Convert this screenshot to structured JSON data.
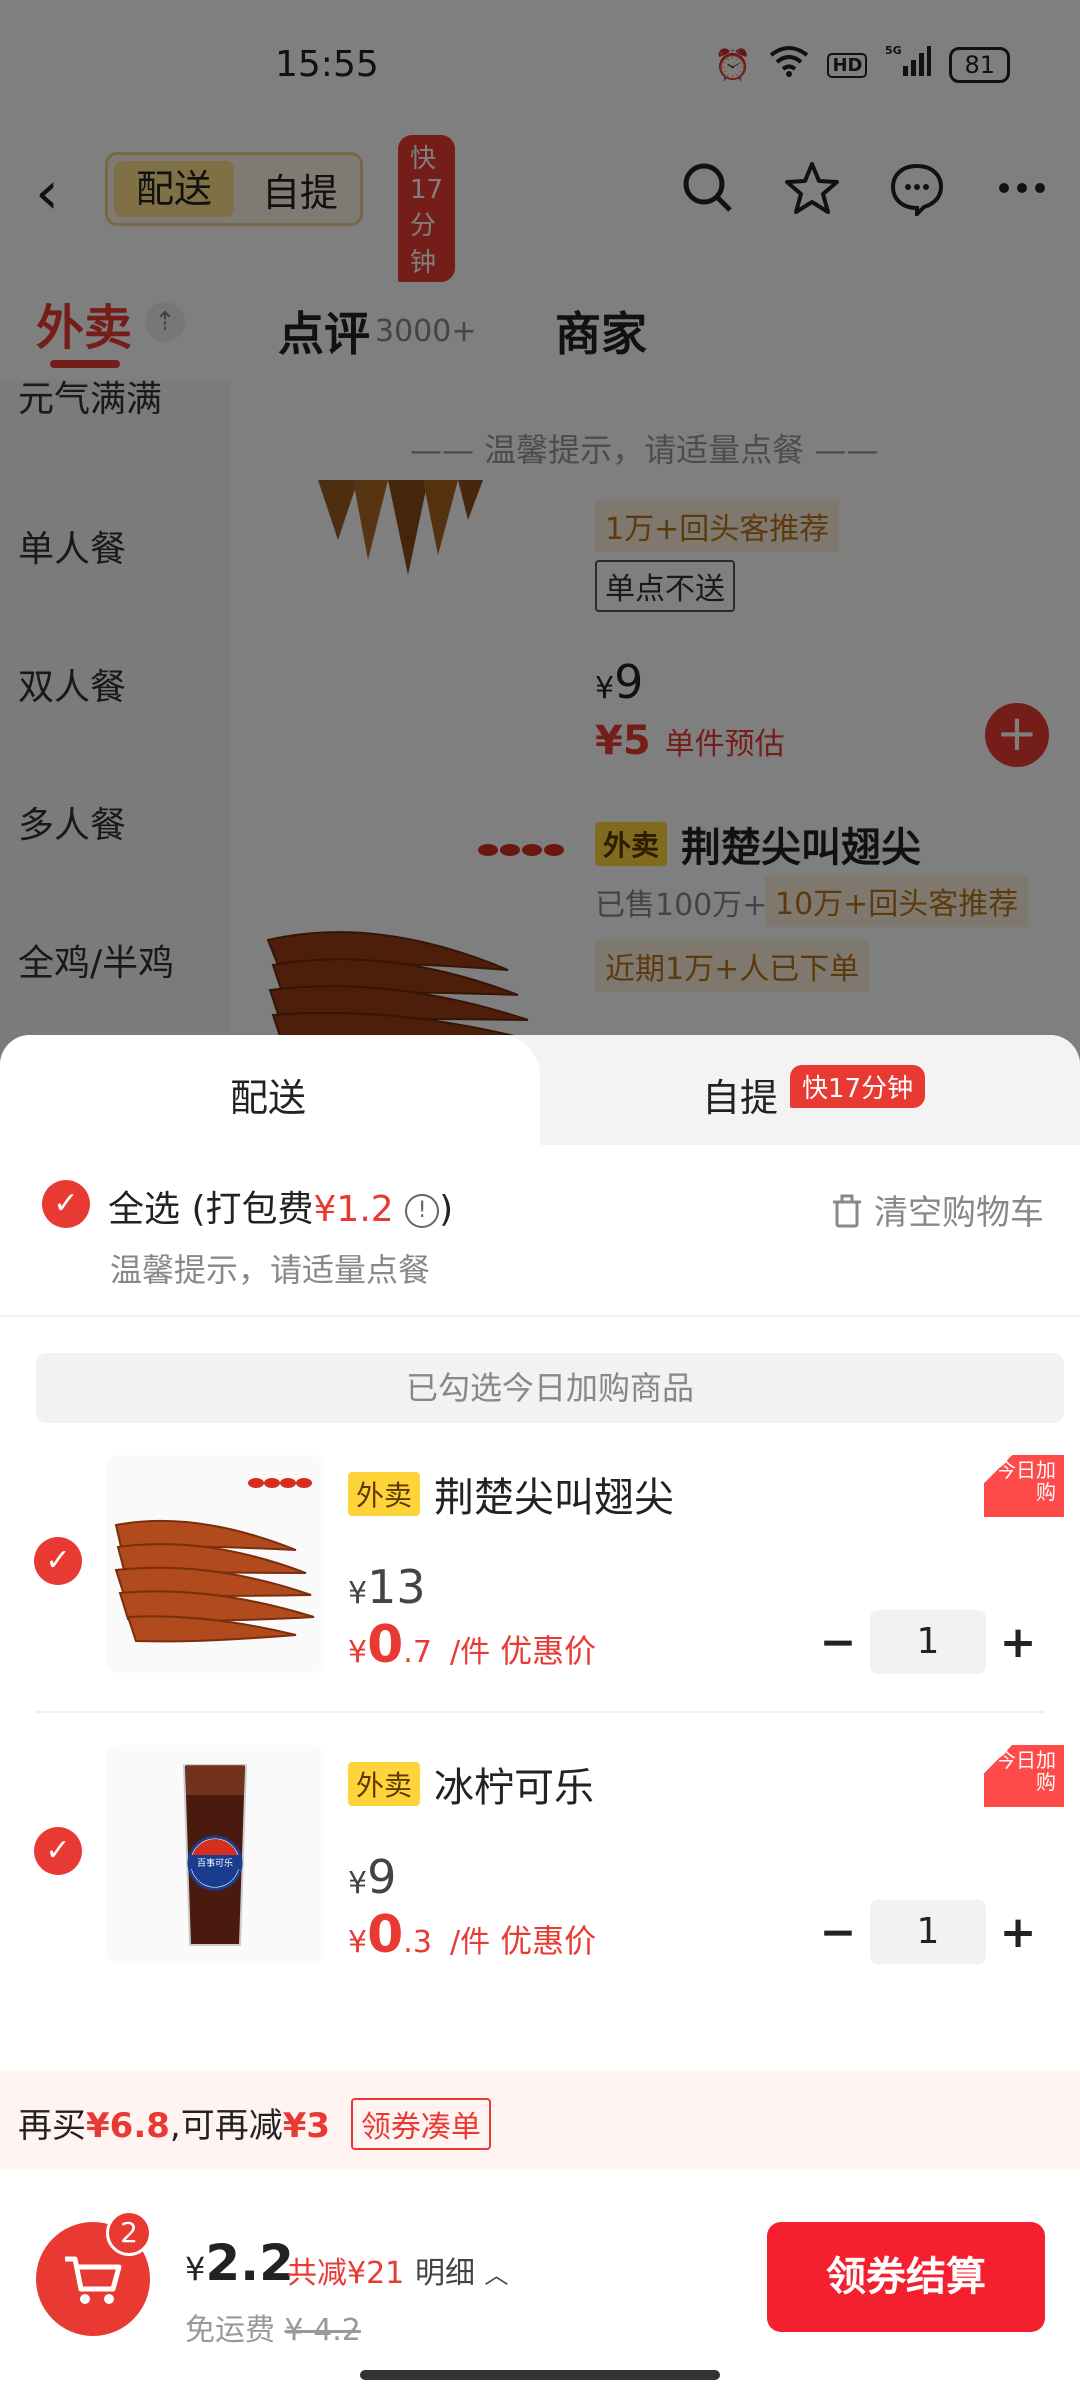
{
  "status_bar": {
    "time": "15:55",
    "network": "5G",
    "hd": "HD",
    "battery": "81"
  },
  "header": {
    "mode_delivery": "配送",
    "mode_pickup": "自提",
    "fast_badge": "快17分钟",
    "tabs": [
      {
        "label": "外卖"
      },
      {
        "label": "点评",
        "count": "3000+"
      },
      {
        "label": "商家"
      }
    ]
  },
  "sidebar": {
    "items": [
      "元气满满",
      "单人餐",
      "双人餐",
      "多人餐",
      "全鸡/半鸡"
    ]
  },
  "menu_bg": {
    "notice": "—— 温馨提示，请适量点餐 ——",
    "item1_tag": "1万+回头客推荐",
    "item1_no_single": "单点不送",
    "item1_orig_price": "9",
    "item1_price": "5",
    "item1_price_label": "单件预估",
    "item2_badge": "外卖",
    "item2_title": "荆楚尖叫翅尖",
    "item2_sold": "已售100万+",
    "item2_tag1": "10万+回头客推荐",
    "item2_tag2": "近期1万+人已下单"
  },
  "sheet": {
    "tab_delivery": "配送",
    "tab_pickup": "自提",
    "tab_pickup_badge": "快17分钟",
    "select_all": "全选",
    "packing_fee_label": "(打包费",
    "packing_fee": "¥1.2",
    "packing_fee_close": ")",
    "clear_cart": "清空购物车",
    "hint": "温馨提示，请适量点餐",
    "section_label": "已勾选今日加购商品",
    "items": [
      {
        "badge": "外卖",
        "name": "荆楚尖叫翅尖",
        "orig_price": "13",
        "price_int": "0",
        "price_dec": ".7",
        "unit": "/件",
        "price_label": "优惠价",
        "corner": "今日加购",
        "qty": "1"
      },
      {
        "badge": "外卖",
        "name": "冰柠可乐",
        "orig_price": "9",
        "price_int": "0",
        "price_dec": ".3",
        "unit": "/件",
        "price_label": "优惠价",
        "corner": "今日加购",
        "qty": "1"
      }
    ]
  },
  "promo": {
    "pre": "再买",
    "amount": "¥6.8",
    "mid": ",可再减",
    "discount": "¥3",
    "button": "领券凑单"
  },
  "cart": {
    "count": "2",
    "total": "2.2",
    "saved": "共减¥21",
    "detail": "明细",
    "shipping_label": "免运费",
    "shipping_orig": "¥ 4.2",
    "checkout": "领券结算"
  },
  "colors": {
    "accent": "#e83a33",
    "checkout": "#f5202f",
    "badge_yellow": "#ffd43b"
  }
}
